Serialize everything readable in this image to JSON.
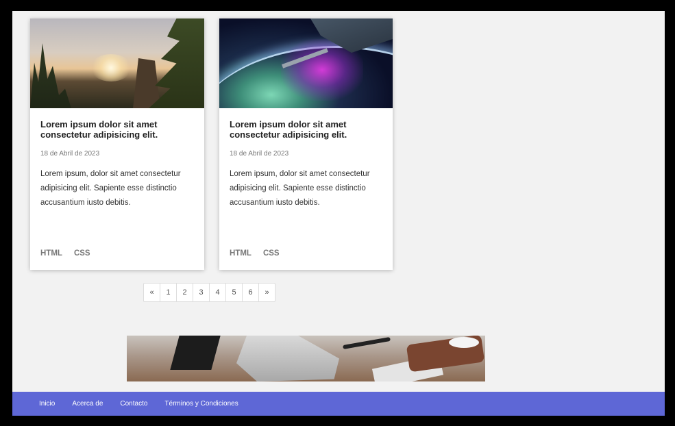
{
  "cards": [
    {
      "title": "Lorem ipsum dolor sit amet consectetur adipisicing elit.",
      "date": "18 de Abril de 2023",
      "text": "Lorem ipsum, dolor sit amet consectetur adipisicing elit. Sapiente esse distinctio accusantium iusto debitis.",
      "tags": [
        "HTML",
        "CSS"
      ],
      "image_icon": "forest-sunset-image"
    },
    {
      "title": "Lorem ipsum dolor sit amet consectetur adipisicing elit.",
      "date": "18 de Abril de 2023",
      "text": "Lorem ipsum, dolor sit amet consectetur adipisicing elit. Sapiente esse distinctio accusantium iusto debitis.",
      "tags": [
        "HTML",
        "CSS"
      ],
      "image_icon": "space-station-image"
    }
  ],
  "pagination": {
    "prev": "«",
    "pages": [
      "1",
      "2",
      "3",
      "4",
      "5",
      "6"
    ],
    "next": "»"
  },
  "footer": {
    "links": [
      "Inicio",
      "Acerca de",
      "Contacto",
      "Términos y Condiciones"
    ],
    "background": "#5e67d6"
  }
}
